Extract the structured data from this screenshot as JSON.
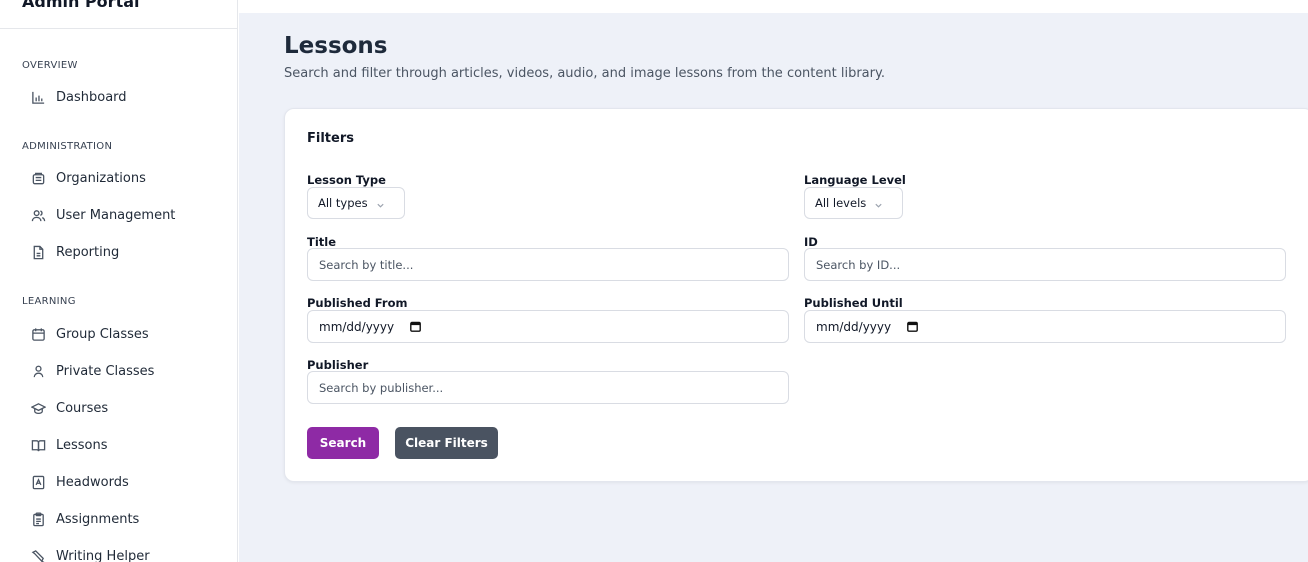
{
  "sidebar": {
    "brand": "Admin Portal",
    "sections": {
      "overview": {
        "title": "OVERVIEW",
        "items": [
          {
            "label": "Dashboard",
            "icon": "bar-chart-icon"
          }
        ]
      },
      "administration": {
        "title": "ADMINISTRATION",
        "items": [
          {
            "label": "Organizations",
            "icon": "building-icon"
          },
          {
            "label": "User Management",
            "icon": "users-icon"
          },
          {
            "label": "Reporting",
            "icon": "file-report-icon"
          }
        ]
      },
      "learning": {
        "title": "LEARNING",
        "items": [
          {
            "label": "Group Classes",
            "icon": "calendar-icon"
          },
          {
            "label": "Private Classes",
            "icon": "user-icon"
          },
          {
            "label": "Courses",
            "icon": "graduation-cap-icon"
          },
          {
            "label": "Lessons",
            "icon": "open-book-icon"
          },
          {
            "label": "Headwords",
            "icon": "dictionary-icon"
          },
          {
            "label": "Assignments",
            "icon": "clipboard-icon"
          },
          {
            "label": "Writing Helper",
            "icon": "pen-icon"
          }
        ]
      }
    }
  },
  "header": {
    "title": "Lessons",
    "subtitle": "Search and filter through articles, videos, audio, and image lessons from the content library."
  },
  "filters": {
    "title": "Filters",
    "lesson_type": {
      "label": "Lesson Type",
      "value": "All types"
    },
    "language_level": {
      "label": "Language Level",
      "value": "All levels"
    },
    "title_field": {
      "label": "Title",
      "placeholder": "Search by title..."
    },
    "id_field": {
      "label": "ID",
      "placeholder": "Search by ID..."
    },
    "published_from": {
      "label": "Published From",
      "value": "mm/dd/yyyy"
    },
    "published_until": {
      "label": "Published Until",
      "value": "mm/dd/yyyy"
    },
    "publisher": {
      "label": "Publisher",
      "placeholder": "Search by publisher..."
    },
    "search_button": "Search",
    "clear_button": "Clear Filters"
  },
  "colors": {
    "primary_button": "#8e2aa5",
    "secondary_button": "#4a5361",
    "main_background": "#eef1f8"
  }
}
